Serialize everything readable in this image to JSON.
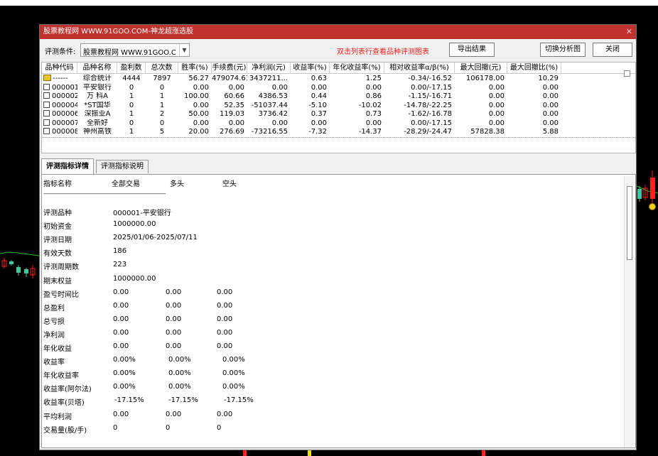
{
  "window": {
    "title": "股票教程网 WWW.91GOO.COM-神龙超涨选股",
    "close_icon": "close-icon"
  },
  "toolbar": {
    "condition_label": "评测条件:",
    "condition_value": "股票教程网 WWW.91GOO.C",
    "hint": "双击列表行查看品种评测图表",
    "export_label": "导出结果",
    "switch_label": "切换分析图",
    "close_label": "关闭"
  },
  "table": {
    "columns": [
      "品种代码",
      "品种名称",
      "盈利数",
      "总次数",
      "胜率(%)",
      "手续费(元)",
      "净利润(元)",
      "收益率(%)",
      "年化收益率(%)",
      "相对收益率α/β(%)",
      "最大回撤(元)",
      "最大回撤比(%)"
    ],
    "rows": [
      [
        "------",
        "综合统计",
        "4444",
        "7897",
        "56.27",
        "479074.61",
        "3437211...",
        "0.63",
        "1.25",
        "-0.34/-16.52",
        "106178.00",
        "10.29"
      ],
      [
        "000001",
        "平安银行",
        "0",
        "0",
        "0.00",
        "0.00",
        "0.00",
        "0.00",
        "0.00",
        "0.00/-17.15",
        "0.00",
        "0.00"
      ],
      [
        "000002",
        "万 科A",
        "1",
        "1",
        "100.00",
        "60.66",
        "4386.53",
        "0.44",
        "0.86",
        "-1.15/-16.71",
        "0.00",
        "0.00"
      ],
      [
        "000004",
        "*ST国华",
        "0",
        "1",
        "0.00",
        "52.35",
        "-51037.44",
        "-5.10",
        "-10.02",
        "-14.78/-22.25",
        "0.00",
        "0.00"
      ],
      [
        "000006",
        "深振业A",
        "1",
        "2",
        "50.00",
        "119.03",
        "3736.42",
        "0.37",
        "0.73",
        "-1.62/-16.78",
        "0.00",
        "0.00"
      ],
      [
        "000007",
        "全新好",
        "0",
        "0",
        "0.00",
        "0.00",
        "0.00",
        "0.00",
        "0.00",
        "0.00/-17.15",
        "0.00",
        "0.00"
      ],
      [
        "000008",
        "神州高铁",
        "1",
        "5",
        "20.00",
        "276.69",
        "-73216.55",
        "-7.32",
        "-14.37",
        "-28.29/-24.47",
        "57828.38",
        "5.88"
      ]
    ]
  },
  "tabs": [
    "评测指标详情",
    "评测指标说明"
  ],
  "detail": {
    "headers": [
      "指标名称",
      "全部交易",
      "多头",
      "空头"
    ],
    "separator": "------------------------------------------------------------------------------------------------",
    "info": [
      {
        "label": "评测品种",
        "value": "000001-平安银行"
      },
      {
        "label": "初始资金",
        "value": "1000000.00"
      },
      {
        "label": "评测日期",
        "value": "2025/01/06-2025/07/11"
      },
      {
        "label": "有效天数",
        "value": "186"
      },
      {
        "label": "评测周期数",
        "value": "223"
      },
      {
        "label": "期末权益",
        "value": "1000000.00"
      }
    ],
    "stats": [
      {
        "label": "盈亏时间比",
        "values": [
          "0.00",
          "0.00",
          "0.00"
        ]
      },
      {
        "label": "总盈利",
        "values": [
          "0.00",
          "0.00",
          "0.00"
        ]
      },
      {
        "label": "总亏损",
        "values": [
          "0.00",
          "0.00",
          "0.00"
        ]
      },
      {
        "label": "净利润",
        "values": [
          "0.00",
          "0.00",
          "0.00"
        ]
      },
      {
        "label": "年化收益",
        "values": [
          "0.00",
          "0.00",
          "0.00"
        ]
      },
      {
        "label": "收益率",
        "values": [
          "0.00%",
          "0.00%",
          "0.00%"
        ]
      },
      {
        "label": "年化收益率",
        "values": [
          "0.00%",
          "0.00%",
          "0.00%"
        ]
      },
      {
        "label": "收益率(阿尔法)",
        "values": [
          "0.00%",
          "0.00%",
          "0.00%"
        ]
      },
      {
        "label": "收益率(贝塔)",
        "values": [
          "-17.15%",
          "-17.15%",
          "-17.15%"
        ]
      },
      {
        "label": "平均利润",
        "values": [
          "0.00",
          "0.00",
          "0.00"
        ]
      },
      {
        "label": "交易量(股/手)",
        "values": [
          "0",
          "0",
          "0"
        ]
      }
    ]
  },
  "colors": {
    "title_bar": "#c0322d",
    "hint_text": "#e0201a",
    "chart_bg": "#000000",
    "candle_up": "#ff2020",
    "candle_down": "#3cc8a0",
    "ma_line": "#22c322"
  }
}
